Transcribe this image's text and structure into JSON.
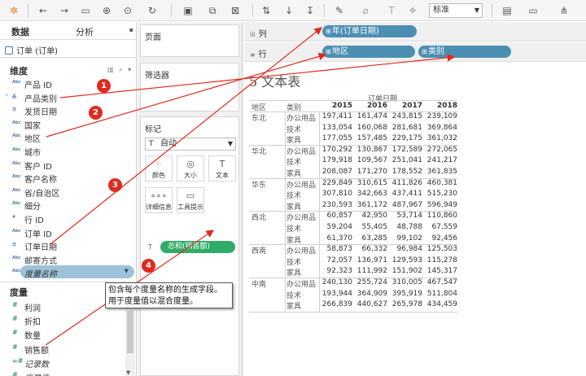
{
  "toolbar": {
    "std_select_value": "标准"
  },
  "left_panel": {
    "tab_data": "数据",
    "tab_analysis": "分析",
    "datasource": "订单 (订单)",
    "dimensions_header": "维度",
    "dimensions": [
      {
        "type": "Abc",
        "label": "产品 ID"
      },
      {
        "type": "品",
        "label": "产品类别"
      },
      {
        "type": "日",
        "label": "发货日期"
      },
      {
        "type": "Abc",
        "label": "国家"
      },
      {
        "type": "Abc",
        "label": "地区"
      },
      {
        "type": "Abc",
        "label": "城市"
      },
      {
        "type": "Abc",
        "label": "客户 ID"
      },
      {
        "type": "Abc",
        "label": "客户名称"
      },
      {
        "type": "Abc",
        "label": "省/自治区"
      },
      {
        "type": "Abc",
        "label": "细分"
      },
      {
        "type": "#",
        "label": "行 ID"
      },
      {
        "type": "Abc",
        "label": "订单 ID"
      },
      {
        "type": "日",
        "label": "订单日期"
      },
      {
        "type": "Abc",
        "label": "邮寄方式"
      },
      {
        "type": "Abc",
        "label": "度量名称"
      }
    ],
    "measures_header": "度量",
    "measures": [
      {
        "type": "#",
        "label": "利润"
      },
      {
        "type": "#",
        "label": "折扣"
      },
      {
        "type": "#",
        "label": "数量"
      },
      {
        "type": "#",
        "label": "销售额"
      },
      {
        "type": "=#",
        "label": "记录数"
      },
      {
        "type": "#",
        "label": "度量值"
      }
    ]
  },
  "middle_panel": {
    "pages_title": "页面",
    "filters_title": "筛选器",
    "marks_title": "标记",
    "mark_type": "自动",
    "mark_buttons": [
      {
        "icon": "color-icon",
        "label": "颜色"
      },
      {
        "icon": "size-icon",
        "label": "大小"
      },
      {
        "icon": "text-icon",
        "label": "文本"
      },
      {
        "icon": "detail-icon",
        "label": "详细信息"
      },
      {
        "icon": "tooltip-icon",
        "label": "工具提示"
      }
    ],
    "text_pill": "总和(销售额)"
  },
  "shelves": {
    "columns_label": "列",
    "rows_label": "行",
    "column_pills": [
      "年(订单日期)"
    ],
    "row_pills": [
      "地区",
      "类别"
    ]
  },
  "view": {
    "title": "5 文本表",
    "column_group_header": "订单日期",
    "region_header": "地区",
    "category_header": "类别",
    "years": [
      "2015",
      "2016",
      "2017",
      "2018"
    ],
    "rows": [
      {
        "region": "东北",
        "category": "办公用品",
        "values": [
          "197,411",
          "161,474",
          "243,815",
          "239,109"
        ]
      },
      {
        "region": "",
        "category": "技术",
        "values": [
          "133,054",
          "160,068",
          "281,681",
          "369,864"
        ]
      },
      {
        "region": "",
        "category": "家具",
        "values": [
          "177,055",
          "157,485",
          "229,175",
          "361,032"
        ]
      },
      {
        "region": "华北",
        "category": "办公用品",
        "values": [
          "170,292",
          "130,867",
          "172,589",
          "272,065"
        ]
      },
      {
        "region": "",
        "category": "技术",
        "values": [
          "179,918",
          "109,567",
          "251,041",
          "241,217"
        ]
      },
      {
        "region": "",
        "category": "家具",
        "values": [
          "208,087",
          "171,270",
          "178,552",
          "361,835"
        ]
      },
      {
        "region": "华东",
        "category": "办公用品",
        "values": [
          "229,849",
          "310,615",
          "411,826",
          "460,381"
        ]
      },
      {
        "region": "",
        "category": "技术",
        "values": [
          "307,810",
          "342,663",
          "437,411",
          "515,230"
        ]
      },
      {
        "region": "",
        "category": "家具",
        "values": [
          "230,593",
          "361,172",
          "487,967",
          "596,949"
        ]
      },
      {
        "region": "西北",
        "category": "办公用品",
        "values": [
          "60,857",
          "42,950",
          "53,714",
          "110,860"
        ]
      },
      {
        "region": "",
        "category": "技术",
        "values": [
          "59,204",
          "55,405",
          "48,788",
          "67,559"
        ]
      },
      {
        "region": "",
        "category": "家具",
        "values": [
          "61,370",
          "63,285",
          "99,102",
          "92,456"
        ]
      },
      {
        "region": "西南",
        "category": "办公用品",
        "values": [
          "58,873",
          "66,332",
          "96,984",
          "125,503"
        ]
      },
      {
        "region": "",
        "category": "技术",
        "values": [
          "72,057",
          "136,971",
          "129,593",
          "115,278"
        ]
      },
      {
        "region": "",
        "category": "家具",
        "values": [
          "92,323",
          "111,992",
          "151,902",
          "145,317"
        ]
      },
      {
        "region": "中南",
        "category": "办公用品",
        "values": [
          "240,130",
          "255,724",
          "310,005",
          "467,547"
        ]
      },
      {
        "region": "",
        "category": "技术",
        "values": [
          "193,944",
          "364,909",
          "395,919",
          "511,804"
        ]
      },
      {
        "region": "",
        "category": "家具",
        "values": [
          "266,839",
          "440,627",
          "265,978",
          "434,459"
        ]
      }
    ]
  },
  "annotation": {
    "tooltip_line1": "包含每个度量名称的生成字段。",
    "tooltip_line2": "用于度量值以混合度量。",
    "badges": [
      "1",
      "2",
      "3",
      "4"
    ],
    "arrow_color": "#e02a1f"
  }
}
